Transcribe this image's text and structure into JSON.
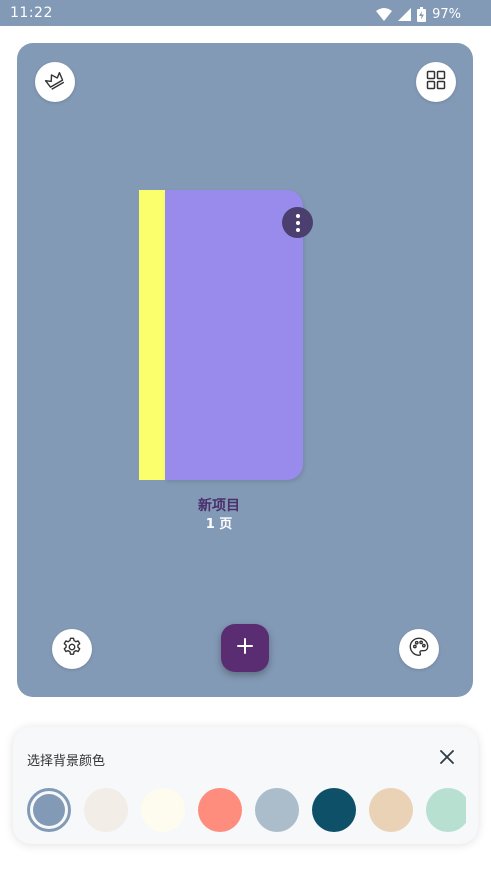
{
  "status_bar": {
    "time": "11:22",
    "battery": "97%",
    "wifi_icon": "wifi-icon",
    "signal_icon": "signal-icon",
    "battery_icon": "battery-icon"
  },
  "board": {
    "background_color": "#839ab6",
    "top_left_icon": "crown-icon",
    "top_right_icon": "grid-view-icon",
    "bottom_left_icon": "settings-icon",
    "bottom_right_icon": "palette-icon",
    "fab_icon": "plus-icon",
    "notebook": {
      "title": "新项目",
      "pages": "1 页",
      "spine_color": "#fcff6c",
      "cover_color": "#988bec",
      "menu_icon": "more-vertical-icon"
    }
  },
  "color_picker": {
    "title": "选择背景颜色",
    "close_icon": "close-icon",
    "selected_index": 0,
    "swatches": [
      "#839ab6",
      "#f2ede6",
      "#fefcef",
      "#fe8d7e",
      "#abbcca",
      "#0f5069",
      "#e9d2b6",
      "#b7e0d1"
    ]
  }
}
